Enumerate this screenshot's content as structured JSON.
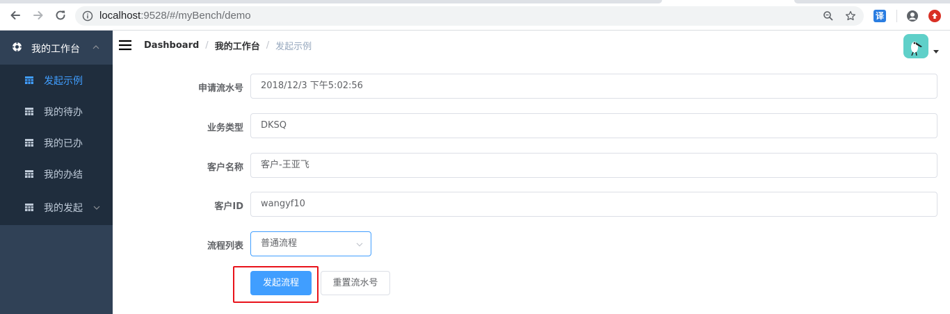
{
  "browser": {
    "url_host": "localhost",
    "url_rest": ":9528/#/myBench/demo",
    "translate_ext": "译"
  },
  "sidebar": {
    "group_label": "我的工作台",
    "items": [
      {
        "label": "发起示例",
        "active": true
      },
      {
        "label": "我的待办",
        "active": false
      },
      {
        "label": "我的已办",
        "active": false
      },
      {
        "label": "我的办结",
        "active": false
      },
      {
        "label": "我的发起",
        "active": false
      }
    ]
  },
  "breadcrumb": {
    "items": [
      "Dashboard",
      "我的工作台",
      "发起示例"
    ],
    "separator": "/"
  },
  "form": {
    "serial": {
      "label": "申请流水号",
      "value": "2018/12/3 下午5:02:56"
    },
    "business_type": {
      "label": "业务类型",
      "value": "DKSQ"
    },
    "customer_name": {
      "label": "客户名称",
      "value": "客户-王亚飞"
    },
    "customer_id": {
      "label": "客户ID",
      "value": "wangyf10"
    },
    "process_list": {
      "label": "流程列表",
      "value": "普通流程"
    }
  },
  "buttons": {
    "start": "发起流程",
    "reset": "重置流水号"
  },
  "colors": {
    "sidebar_bg": "#304156",
    "submenu_bg": "#1f2d3d",
    "primary": "#409eff",
    "highlight": "#e8121a",
    "avatar_bg": "#5fd0c9"
  }
}
